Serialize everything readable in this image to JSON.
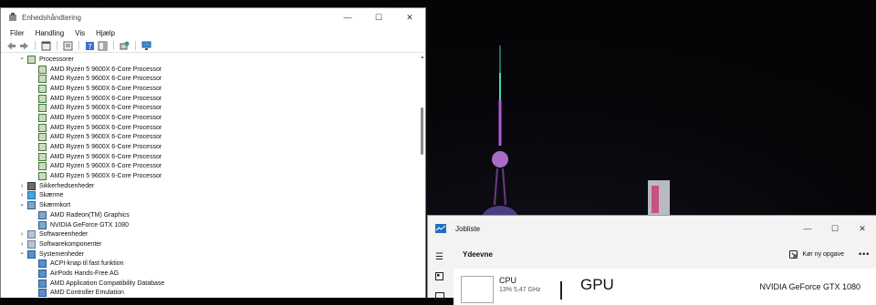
{
  "device_manager": {
    "title": "Enhedshåndtering",
    "controls": {
      "minimize": "—",
      "maximize": "☐",
      "close": "✕"
    },
    "menu": [
      "Filer",
      "Handling",
      "Vis",
      "Hjælp"
    ],
    "tree": [
      {
        "label": "Processorer",
        "icon": "cpu-icon",
        "expander": "chevron-down",
        "indent": 1
      },
      {
        "label": "AMD Ryzen 5 9600X 6-Core Processor",
        "icon": "cpu-icon",
        "indent": 2
      },
      {
        "label": "AMD Ryzen 5 9600X 6-Core Processor",
        "icon": "cpu-icon",
        "indent": 2
      },
      {
        "label": "AMD Ryzen 5 9600X 6-Core Processor",
        "icon": "cpu-icon",
        "indent": 2
      },
      {
        "label": "AMD Ryzen 5 9600X 6-Core Processor",
        "icon": "cpu-icon",
        "indent": 2
      },
      {
        "label": "AMD Ryzen 5 9600X 6-Core Processor",
        "icon": "cpu-icon",
        "indent": 2
      },
      {
        "label": "AMD Ryzen 5 9600X 6-Core Processor",
        "icon": "cpu-icon",
        "indent": 2
      },
      {
        "label": "AMD Ryzen 5 9600X 6-Core Processor",
        "icon": "cpu-icon",
        "indent": 2
      },
      {
        "label": "AMD Ryzen 5 9600X 6-Core Processor",
        "icon": "cpu-icon",
        "indent": 2
      },
      {
        "label": "AMD Ryzen 5 9600X 6-Core Processor",
        "icon": "cpu-icon",
        "indent": 2
      },
      {
        "label": "AMD Ryzen 5 9600X 6-Core Processor",
        "icon": "cpu-icon",
        "indent": 2
      },
      {
        "label": "AMD Ryzen 5 9600X 6-Core Processor",
        "icon": "cpu-icon",
        "indent": 2
      },
      {
        "label": "AMD Ryzen 5 9600X 6-Core Processor",
        "icon": "cpu-icon",
        "indent": 2
      },
      {
        "label": "Sikkerhedsenheder",
        "icon": "security-device-icon",
        "expander": "chevron-right",
        "indent": 1
      },
      {
        "label": "Skærme",
        "icon": "monitor-icon",
        "expander": "chevron-right",
        "indent": 1
      },
      {
        "label": "Skærmkort",
        "icon": "display-adapter-icon",
        "expander": "chevron-down",
        "indent": 1
      },
      {
        "label": "AMD Radeon(TM) Graphics",
        "icon": "display-adapter-icon",
        "indent": 2
      },
      {
        "label": "NVIDIA GeForce GTX 1080",
        "icon": "display-adapter-icon",
        "indent": 2
      },
      {
        "label": "Softwareenheder",
        "icon": "software-device-icon",
        "expander": "chevron-right",
        "indent": 1
      },
      {
        "label": "Softwarekomponenter",
        "icon": "software-component-icon",
        "expander": "chevron-right",
        "indent": 1
      },
      {
        "label": "Systemenheder",
        "icon": "system-device-icon",
        "expander": "chevron-down",
        "indent": 1
      },
      {
        "label": "ACPI-knap til fast funktion",
        "icon": "system-device-icon",
        "indent": 2
      },
      {
        "label": "AirPods Hands-Free AG",
        "icon": "system-device-icon",
        "indent": 2
      },
      {
        "label": "AMD Application Compatibility Database",
        "icon": "system-device-icon",
        "indent": 2
      },
      {
        "label": "AMD Controller Emulation",
        "icon": "system-device-icon",
        "indent": 2
      }
    ]
  },
  "task_manager": {
    "title": "Jobliste",
    "controls": {
      "minimize": "—",
      "maximize": "☐",
      "close": "✕"
    },
    "page_heading": "Ydeevne",
    "new_task_label": "Kør ny opgave",
    "more_label": "•••",
    "cpu": {
      "name": "CPU",
      "sub": "13%  5,47 GHz"
    },
    "detail": {
      "title": "GPU",
      "model": "NVIDIA GeForce GTX 1080"
    }
  }
}
